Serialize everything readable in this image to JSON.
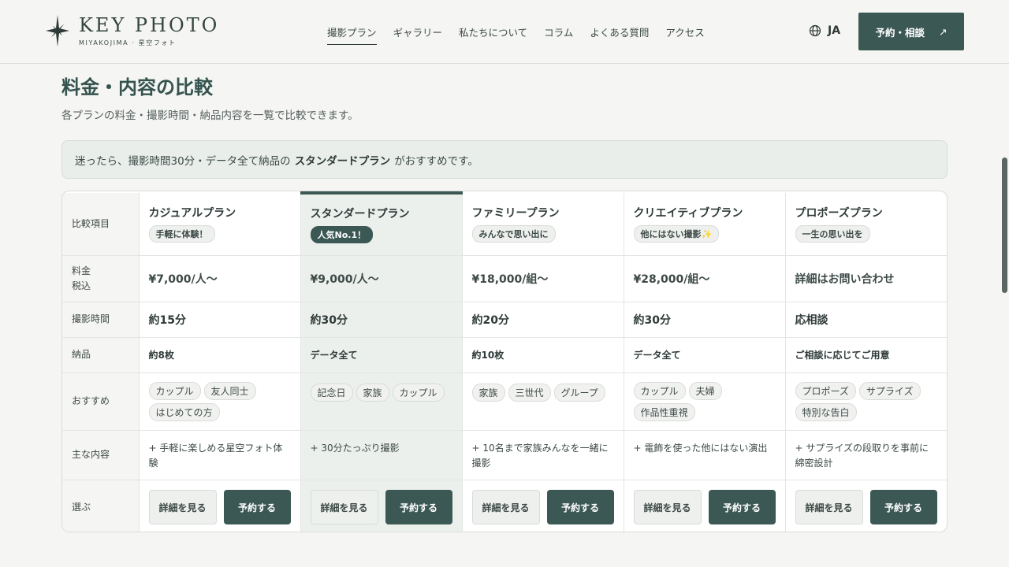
{
  "header": {
    "logo_title": "KEY PHOTO",
    "logo_sub": "MIYAKOJIMA · 星空フォト",
    "nav": [
      "撮影プラン",
      "ギャラリー",
      "私たちについて",
      "コラム",
      "よくある質問",
      "アクセス"
    ],
    "lang": "JA",
    "cta": "予約・相談",
    "cta_icon": "arrow-up-right-icon"
  },
  "section": {
    "title": "料金・内容の比較",
    "desc": "各プランの料金・撮影時間・納品内容を一覧で比較できます。",
    "recommend_pre": "迷ったら、撮影時間30分・データ全て納品の",
    "recommend_plan": "スタンダードプラン",
    "recommend_post": "がおすすめです。"
  },
  "table": {
    "row_labels": {
      "compare": "比較項目",
      "price": "料金",
      "price_note": "税込",
      "time": "撮影時間",
      "delivery": "納品",
      "recommend": "おすすめ",
      "main": "主な内容",
      "select": "選ぶ"
    },
    "plans": [
      {
        "name": "カジュアルプラン",
        "badge": "手軽に体験！",
        "price": "¥7,000/人〜",
        "time": "約15分",
        "delivery": "約8枚",
        "tags": [
          "カップル",
          "友人同士",
          "はじめての方"
        ],
        "main": "+ 手軽に楽しめる星空フォト体験"
      },
      {
        "name": "スタンダードプラン",
        "badge": "人気No.1！",
        "price": "¥9,000/人〜",
        "time": "約30分",
        "delivery": "データ全て",
        "tags": [
          "記念日",
          "家族",
          "カップル"
        ],
        "main": "+ 30分たっぷり撮影"
      },
      {
        "name": "ファミリープラン",
        "badge": "みんなで思い出に",
        "price": "¥18,000/組〜",
        "time": "約20分",
        "delivery": "約10枚",
        "tags": [
          "家族",
          "三世代",
          "グループ"
        ],
        "main": "+ 10名まで家族みんなを一緒に撮影"
      },
      {
        "name": "クリエイティブプラン",
        "badge": "他にはない撮影✨",
        "price": "¥28,000/組〜",
        "time": "約30分",
        "delivery": "データ全て",
        "tags": [
          "カップル",
          "夫婦",
          "作品性重視"
        ],
        "main": "+ 電飾を使った他にはない演出"
      },
      {
        "name": "プロポーズプラン",
        "badge": "一生の思い出を",
        "price": "詳細はお問い合わせ",
        "time": "応相談",
        "delivery": "ご相談に応じてご用意",
        "tags": [
          "プロポーズ",
          "サプライズ",
          "特別な告白"
        ],
        "main": "+ サプライズの段取りを事前に綿密設計"
      }
    ],
    "detail_label": "詳細を見る",
    "book_label": "予約する"
  }
}
